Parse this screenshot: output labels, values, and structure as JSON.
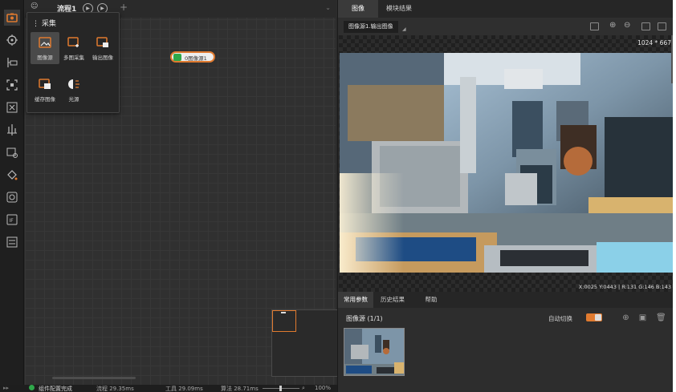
{
  "canvas": {
    "flow_tab": "流程1",
    "add_tab": "+",
    "collapse": "⌄"
  },
  "popup": {
    "title": "⋮ 采集",
    "items": [
      {
        "label": "图像源"
      },
      {
        "label": "多图采集"
      },
      {
        "label": "输出图像"
      },
      {
        "label": "缓存图像"
      },
      {
        "label": "光源"
      }
    ]
  },
  "node": {
    "label": "0图像源1"
  },
  "status": {
    "state": "组件配置完成",
    "flow_time": "流程 29.35ms",
    "tool_time": "工具 29.09ms",
    "algo_time": "算法 28.71ms",
    "zoom": "100%"
  },
  "right": {
    "tabs": [
      {
        "label": "图像"
      },
      {
        "label": "模块结果"
      }
    ],
    "image_source": "图像源1.输出图像",
    "image_size": "1024 * 667",
    "pixel_info": "X:0025  Y:0443  |  R:131  G:146  B:143",
    "bottom_tabs": [
      {
        "label": "常用参数"
      },
      {
        "label": "历史结果"
      },
      {
        "label": "帮助"
      }
    ],
    "source_title": "图像源 (1/1)",
    "auto_switch": "自动切换"
  },
  "colors": {
    "accent": "#e07a2f",
    "run_green": "#2fa84a"
  }
}
